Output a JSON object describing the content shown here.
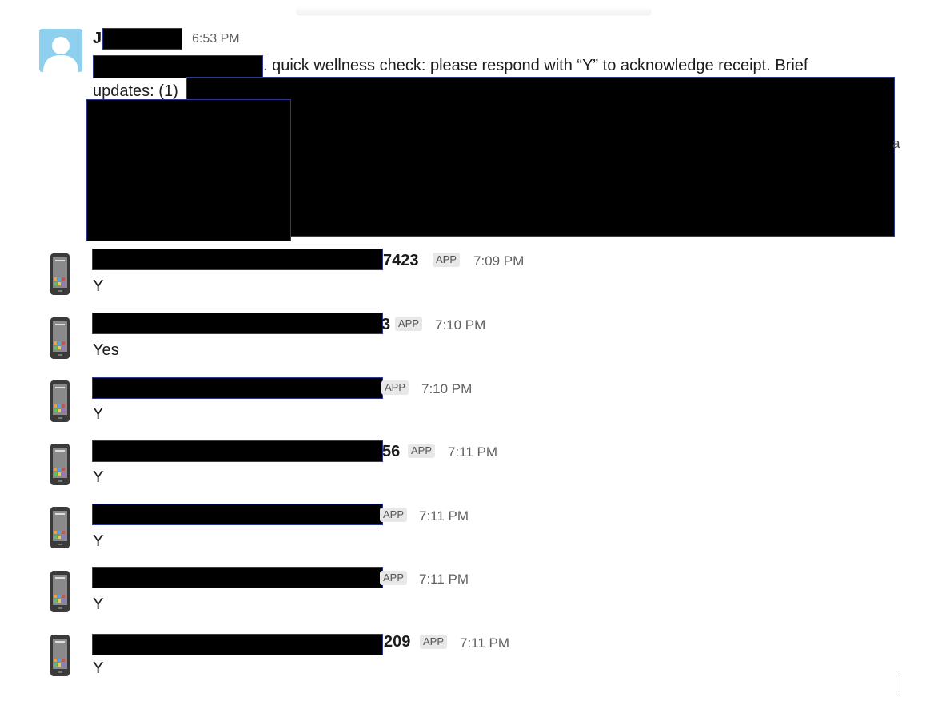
{
  "first_message": {
    "sender_visible": "J",
    "time": "6:53 PM",
    "text_line1": ". quick wellness check: please respond with “Y” to acknowledge receipt. Brief",
    "text_line2": "updates: (1)",
    "stray_char": "a"
  },
  "app_badge_label": "APP",
  "replies": [
    {
      "name_suffix": "7423",
      "time": "7:09 PM",
      "text": "Y"
    },
    {
      "name_suffix": "3",
      "time": "7:10 PM",
      "text": "Yes"
    },
    {
      "name_suffix": "",
      "time": "7:10 PM",
      "text": "Y"
    },
    {
      "name_suffix": "56",
      "time": "7:11 PM",
      "text": "Y"
    },
    {
      "name_suffix": "",
      "time": "7:11 PM",
      "text": "Y"
    },
    {
      "name_suffix": "",
      "time": "7:11 PM",
      "text": "Y"
    },
    {
      "name_suffix": "209",
      "time": "7:11 PM",
      "text": "Y"
    }
  ],
  "icons": {
    "user_avatar": "user-avatar-icon",
    "app_avatar": "phone-app-icon"
  }
}
